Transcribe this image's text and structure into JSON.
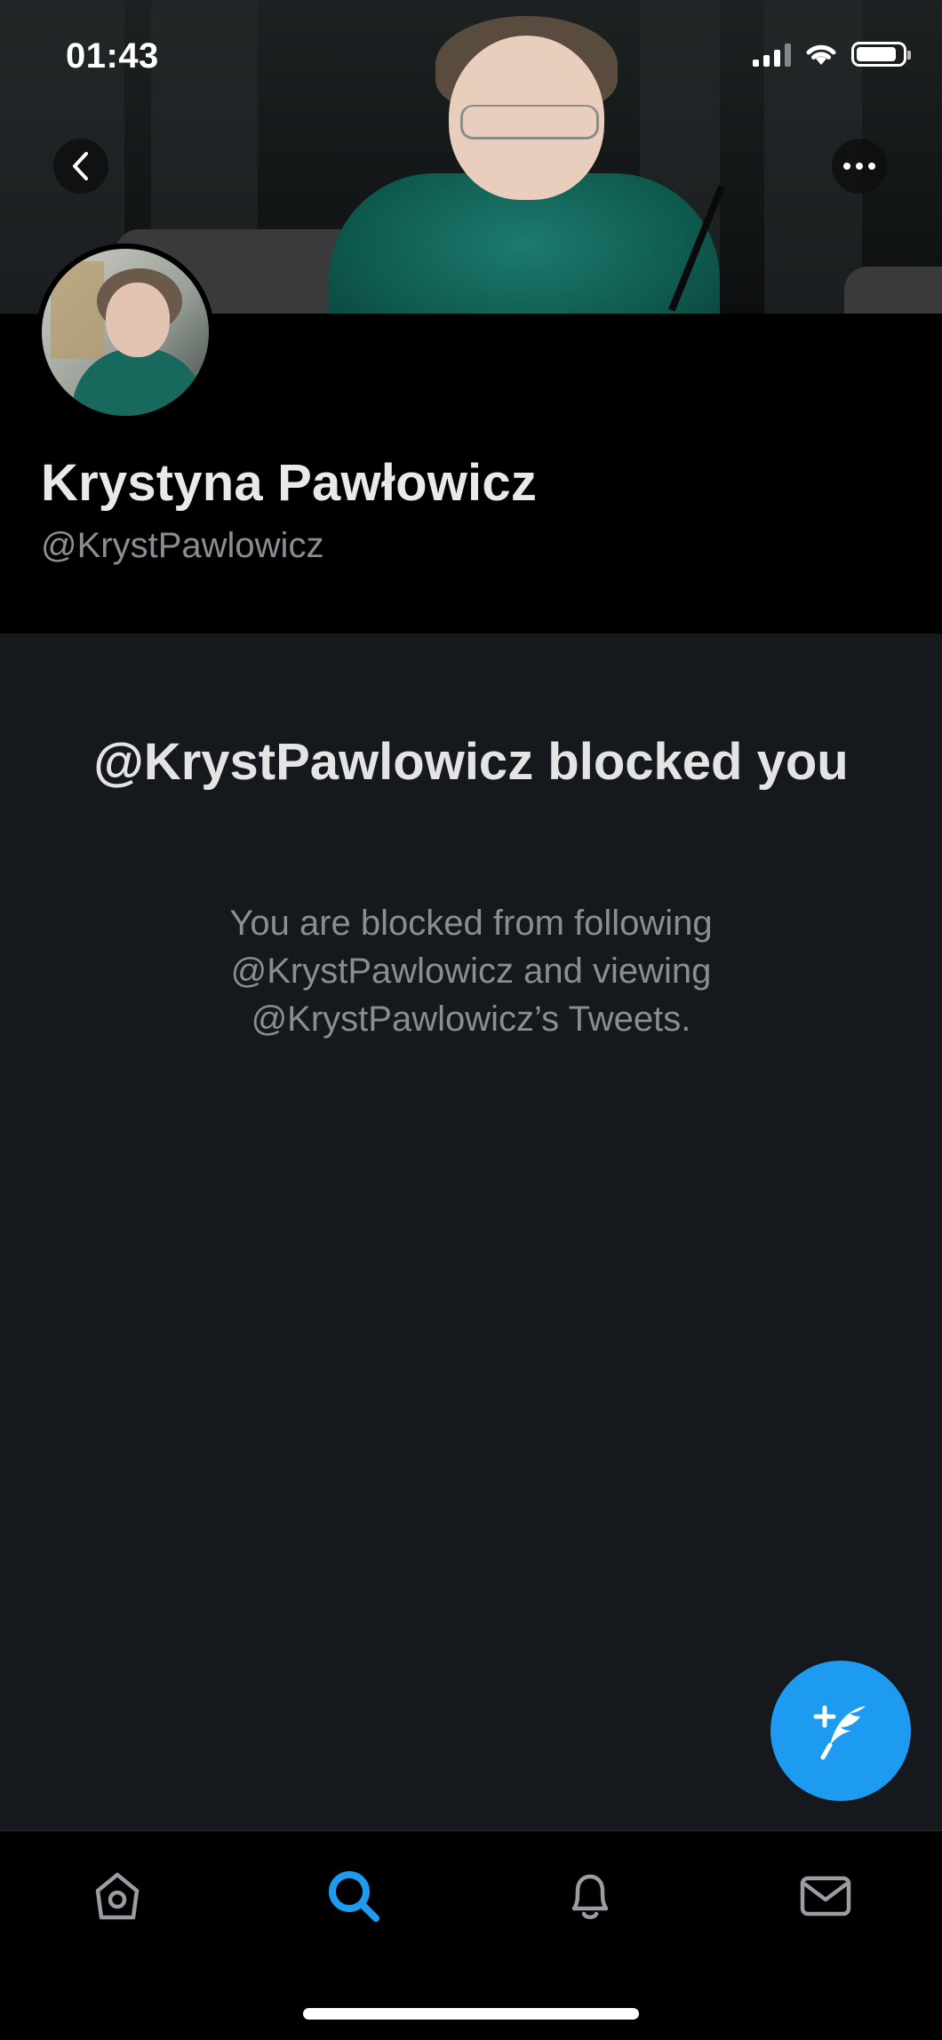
{
  "status_bar": {
    "time": "01:43"
  },
  "profile": {
    "name": "Krystyna Pawłowicz",
    "handle": "@KrystPawlowicz"
  },
  "blocked": {
    "title": "@KrystPawlowicz blocked you",
    "description": "You are blocked from following @KrystPawlowicz and viewing @KrystPawlowicz’s Tweets."
  },
  "colors": {
    "accent": "#1d9bf0",
    "background": "#15181d",
    "tabbar": "#000000"
  },
  "icons": {
    "back": "chevron-left-icon",
    "more": "more-horizontal-icon",
    "compose": "compose-tweet-icon",
    "home": "home-icon",
    "search": "search-icon",
    "notifications": "bell-icon",
    "messages": "mail-icon"
  },
  "tabs": [
    {
      "id": "home",
      "active": false
    },
    {
      "id": "search",
      "active": true
    },
    {
      "id": "notifications",
      "active": false
    },
    {
      "id": "messages",
      "active": false
    }
  ]
}
